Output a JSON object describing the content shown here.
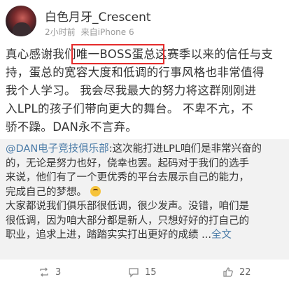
{
  "header": {
    "username": "白色月牙_Crescent",
    "time": "2小时前",
    "source": "来自iPhone 6"
  },
  "body": {
    "lines": [
      "真心感谢我们唯一BOSS蛋总这赛季以来的信任与支",
      "持，蛋总的宽容大度和低调的行事风格也非常值得",
      "我个人学习。    我会尽我最大的努力将这群刚刚进",
      "入LPL的孩子们带向更大的舞台。    不卑不亢，不",
      "骄不躁。DAN永不言弃。"
    ],
    "highlight_color": "#e52b2b"
  },
  "repost": {
    "mention": "@DAN电子竞技俱乐部",
    "line1_rest": ":这次能打进LPL咱们是非常兴奋的",
    "lines": [
      "的，无论是努力也好，侥幸也罢。起码对于我们的选手",
      "来说，他们有了一个更优秀的平台去展示自己的能力，",
      "完成自己的梦想。",
      "大家都说我们俱乐部很低调，很少发声。没错，咱们是",
      "很低调，因为咱大部分都是新人，只想好好的打自己的"
    ],
    "last_line": "职业，追求上进，踏踏实实打出更好的成绩 ...",
    "fulltext_label": "全文",
    "emoji": "grin-emoji",
    "link_color": "#4a7ba7",
    "background": "#f2f2f2"
  },
  "actions": {
    "repost_count": "3",
    "comment_count": "15",
    "like_count": "22"
  }
}
